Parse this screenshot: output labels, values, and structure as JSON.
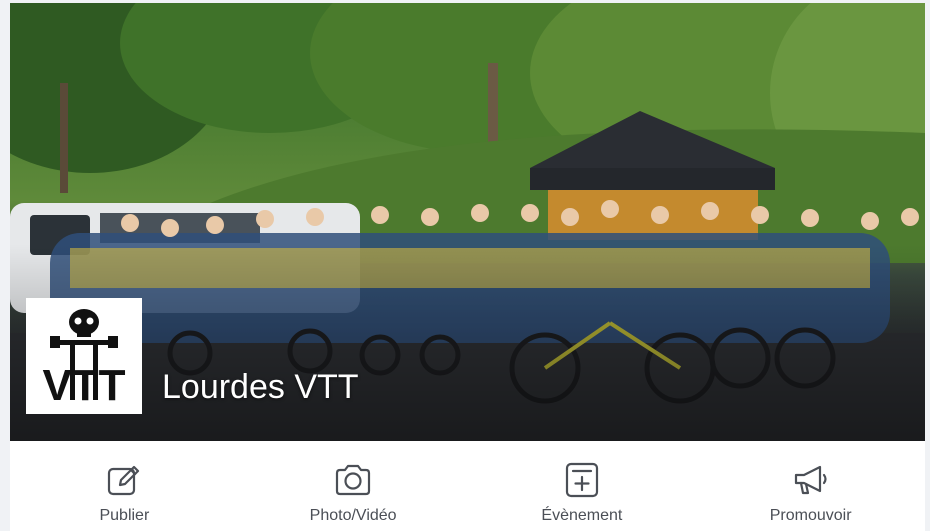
{
  "page": {
    "name": "Lourdes VTT",
    "logo_text": "VTT"
  },
  "actions": [
    {
      "label": "Publier",
      "icon": "edit-icon"
    },
    {
      "label": "Photo/Vidéo",
      "icon": "camera-icon"
    },
    {
      "label": "Évènement",
      "icon": "event-icon"
    },
    {
      "label": "Promouvoir",
      "icon": "megaphone-icon"
    }
  ],
  "colors": {
    "icon": "#4b4f56",
    "label": "#4b4f56"
  }
}
